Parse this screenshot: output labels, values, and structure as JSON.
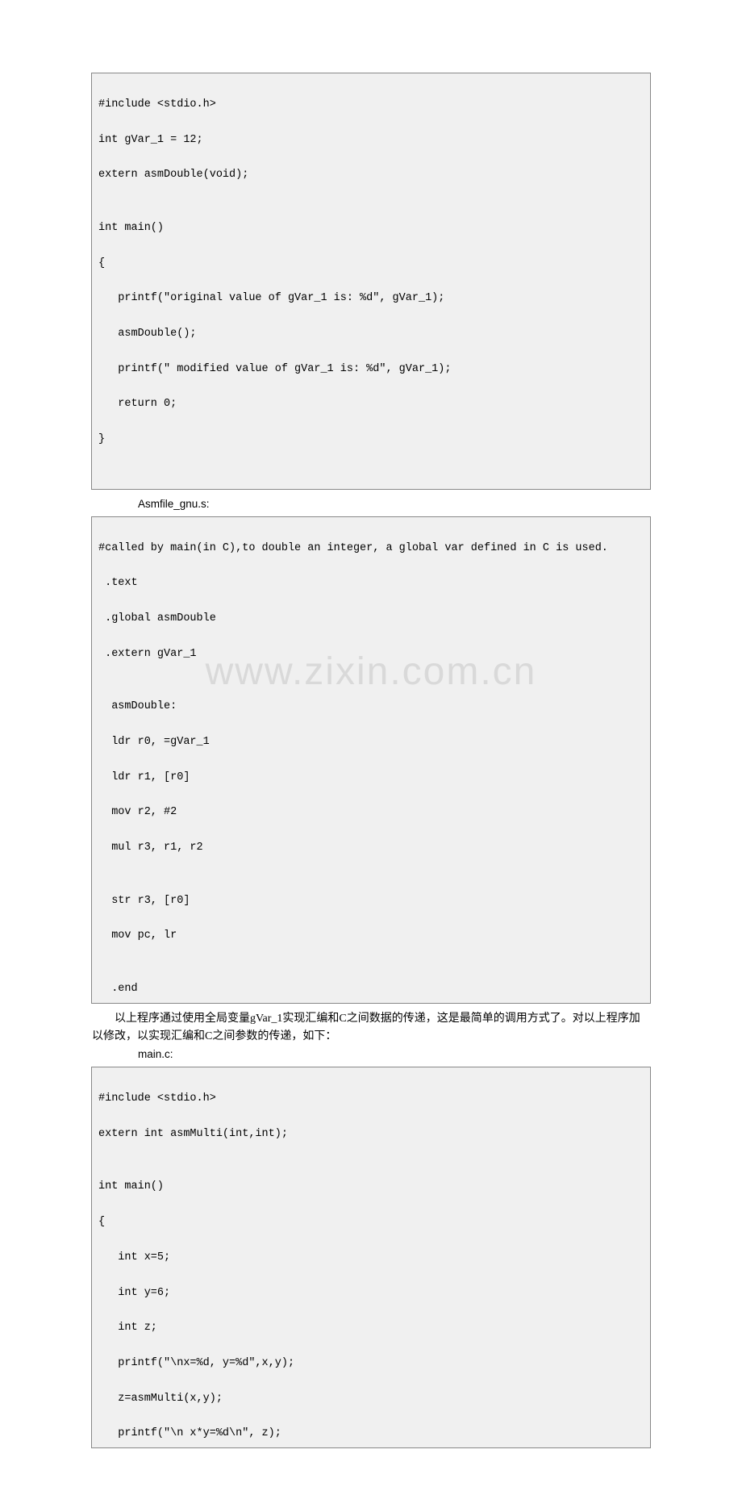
{
  "block1": {
    "l1": "#include <stdio.h>",
    "l2": "int gVar_1 = 12;",
    "l3": "extern asmDouble(void);",
    "l4": "",
    "l5": "int main()",
    "l6": "{",
    "l7": "   printf(\"original value of gVar_1 is: %d\", gVar_1);",
    "l8": "   asmDouble();",
    "l9": "   printf(\" modified value of gVar_1 is: %d\", gVar_1);",
    "l10": "   return 0;",
    "l11": "}",
    "l12": " "
  },
  "label1": "Asmfile_gnu.s:",
  "block2": {
    "l1": "#called by main(in C),to double an integer, a global var defined in C is used.",
    "l2": " .text",
    "l3": " .global asmDouble",
    "l4": " .extern gVar_1",
    "l5": "",
    "l6": "  asmDouble:",
    "l7": "  ldr r0, =gVar_1",
    "l8": "  ldr r1, [r0]",
    "l9": "  mov r2, #2",
    "l10": "  mul r3, r1, r2",
    "l11": "",
    "l12": "  str r3, [r0]",
    "l13": "  mov pc, lr",
    "l14": "",
    "l15": "  .end"
  },
  "watermark": "www.zixin.com.cn",
  "para1": "以上程序通过使用全局变量gVar_1实现汇编和C之间数据的传递，这是最简单的调用方式了。对以上程序加以修改，以实现汇编和C之间参数的传递，如下：",
  "label2": "main.c:",
  "block3": {
    "l1": "#include <stdio.h>",
    "l2": "extern int asmMulti(int,int);",
    "l3": "",
    "l4": "int main()",
    "l5": "{",
    "l6": "   int x=5;",
    "l7": "   int y=6;",
    "l8": "   int z;",
    "l9": "   printf(\"\\nx=%d, y=%d\",x,y);",
    "l10": "   z=asmMulti(x,y);",
    "l11": "   printf(\"\\n x*y=%d\\n\", z);"
  }
}
